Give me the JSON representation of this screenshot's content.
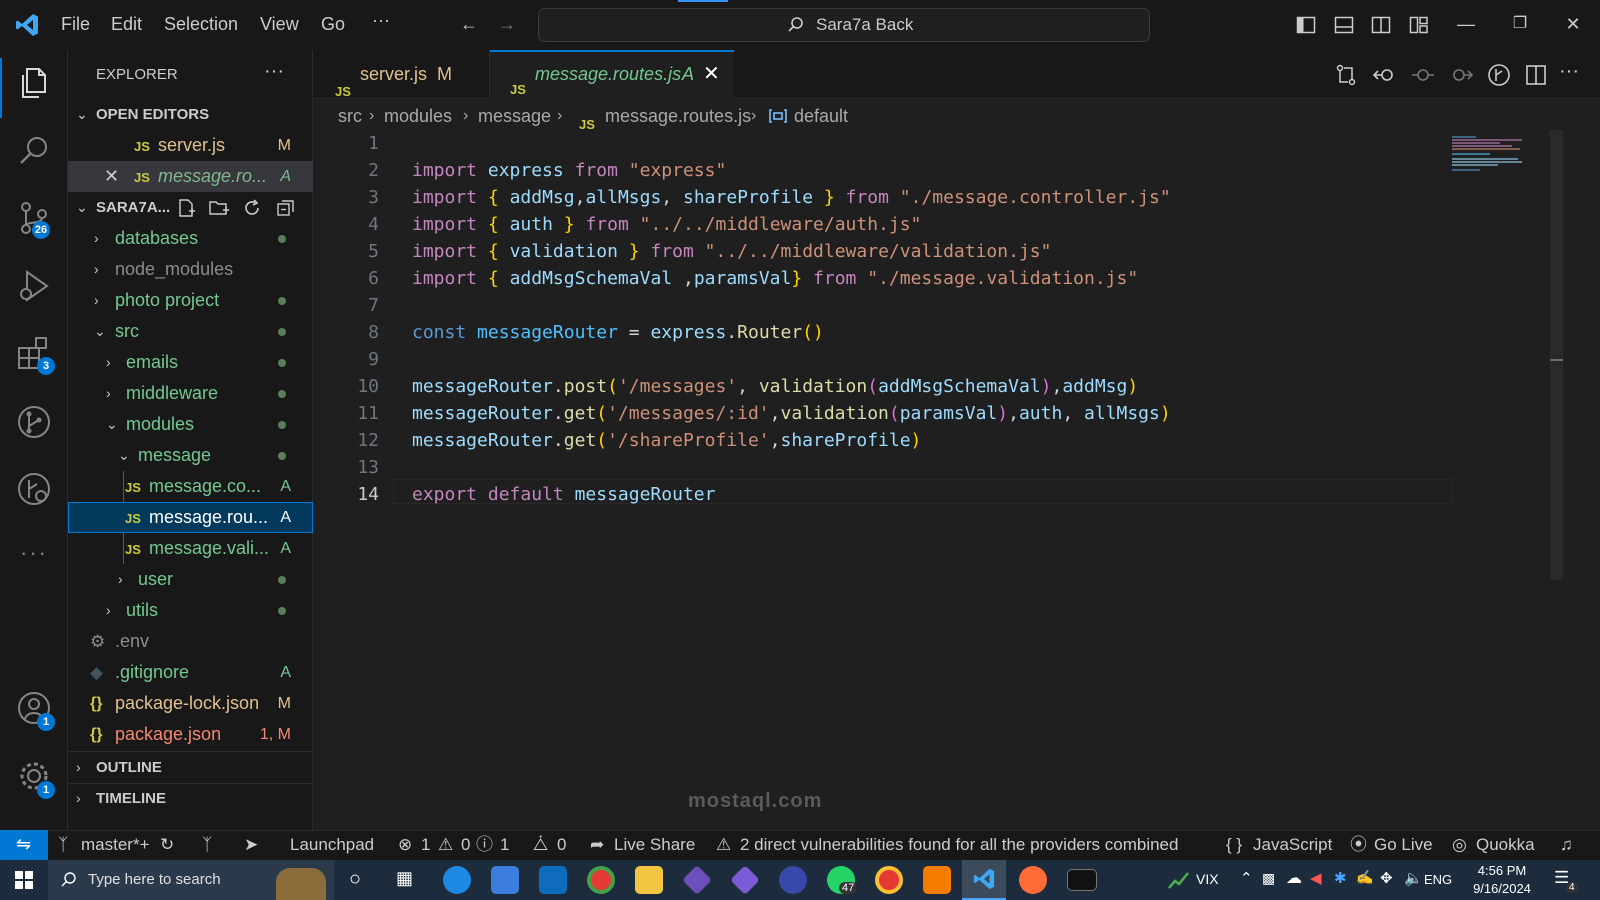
{
  "menu": [
    "File",
    "Edit",
    "Selection",
    "View",
    "Go",
    "···"
  ],
  "search": {
    "label": "Sara7a Back"
  },
  "activity": {
    "scm_badge": "26",
    "ext_badge": "3",
    "account_badge": "1",
    "settings_badge": "1"
  },
  "explorer": {
    "title": "EXPLORER",
    "more": "···",
    "open_editors_title": "OPEN EDITORS",
    "open_editors": [
      {
        "name": "server.js",
        "status": "M"
      },
      {
        "name": "message.ro...",
        "status": "A"
      }
    ],
    "project_title": "SARA7A...",
    "tree": [
      {
        "name": "databases"
      },
      {
        "name": "node_modules"
      },
      {
        "name": "photo project"
      },
      {
        "name": "src"
      },
      {
        "name": "emails"
      },
      {
        "name": "middleware"
      },
      {
        "name": "modules"
      },
      {
        "name": "message"
      },
      {
        "name": "message.co...",
        "status": "A"
      },
      {
        "name": "message.rou...",
        "status": "A"
      },
      {
        "name": "message.vali...",
        "status": "A"
      },
      {
        "name": "user"
      },
      {
        "name": "utils"
      },
      {
        "name": ".env"
      },
      {
        "name": ".gitignore",
        "status": "A"
      },
      {
        "name": "package-lock.json",
        "status": "M"
      },
      {
        "name": "package.json",
        "status": "1, M"
      }
    ],
    "outline": "OUTLINE",
    "timeline": "TIMELINE"
  },
  "tabs": [
    {
      "icon": "JS",
      "name": "server.js",
      "status": "M"
    },
    {
      "icon": "JS",
      "name": "message.routes.js",
      "status": "A"
    }
  ],
  "breadcrumb": [
    "src",
    "modules",
    "message",
    "message.routes.js",
    "default"
  ],
  "code": {
    "line_numbers": [
      "1",
      "2",
      "3",
      "4",
      "5",
      "6",
      "7",
      "8",
      "9",
      "10",
      "11",
      "12",
      "13",
      "14"
    ],
    "lines": [
      "",
      "import express from \"express\"",
      "import { addMsg,allMsgs, shareProfile } from \"./message.controller.js\"",
      "import { auth } from \"../../middleware/auth.js\"",
      "import { validation } from \"../../middleware/validation.js\"",
      "import { addMsgSchemaVal ,paramsVal} from \"./message.validation.js\"",
      "",
      "const messageRouter = express.Router()",
      "",
      "messageRouter.post('/messages', validation(addMsgSchemaVal),addMsg)",
      "messageRouter.get('/messages/:id',validation(paramsVal),auth, allMsgs)",
      "messageRouter.get('/shareProfile',shareProfile)",
      "",
      "export default messageRouter"
    ]
  },
  "statusbar": {
    "branch": "master*+",
    "launchpad": "Launchpad",
    "errors": "1",
    "warnings": "0",
    "infos": "1",
    "ports": "0",
    "live_share": "Live Share",
    "vuln": "2 direct vulnerabilities found for all the providers combined",
    "language": "JavaScript",
    "go_live": "Go Live",
    "quokka": "Quokka"
  },
  "taskbar": {
    "search_placeholder": "Type here to search",
    "whatsapp_badge": "47",
    "stock": "VIX",
    "lang": "ENG",
    "time": "4:56 PM",
    "date": "9/16/2024",
    "notif": "4"
  },
  "watermark": "mostaql.com"
}
